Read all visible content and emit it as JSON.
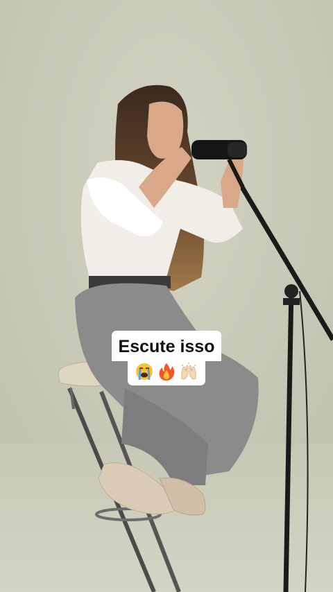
{
  "caption": {
    "text": "Escute isso",
    "emojis": [
      "loudly-crying-face",
      "fire",
      "raising-hands"
    ]
  },
  "colors": {
    "backdrop": "#c9c9b8",
    "caption_bg": "#ffffff",
    "caption_text": "#111111"
  }
}
